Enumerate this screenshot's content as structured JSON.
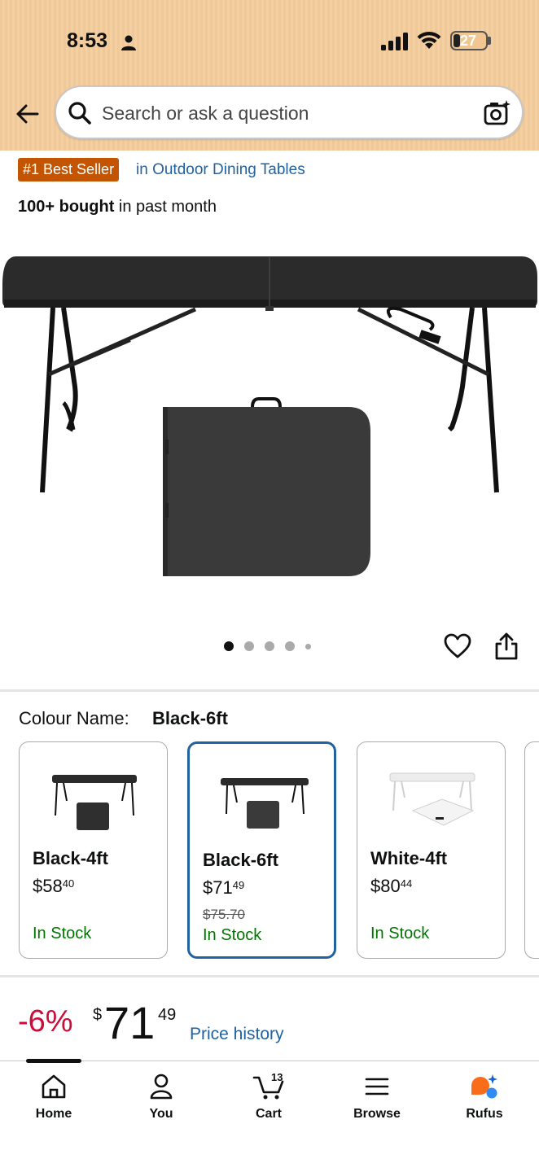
{
  "status_bar": {
    "time": "8:53",
    "battery": "27"
  },
  "search": {
    "placeholder": "Search or ask a question"
  },
  "badge": {
    "label": "#1 Best Seller",
    "category": "in Outdoor Dining Tables"
  },
  "bought": {
    "bold": "100+ bought",
    "rest": " in past month"
  },
  "colour": {
    "label": "Colour Name:",
    "value": "Black-6ft"
  },
  "variants": [
    {
      "name": "Black-4ft",
      "price_dollars": "$58",
      "price_cents": "40",
      "stock": "In Stock",
      "selected": false,
      "color": "black"
    },
    {
      "name": "Black-6ft",
      "price_dollars": "$71",
      "price_cents": "49",
      "was": "$75.70",
      "stock": "In Stock",
      "selected": true,
      "color": "black"
    },
    {
      "name": "White-4ft",
      "price_dollars": "$80",
      "price_cents": "44",
      "stock": "In Stock",
      "selected": false,
      "color": "white"
    }
  ],
  "price": {
    "discount": "-6%",
    "symbol": "$",
    "whole": "71",
    "cents": "49",
    "history_link": "Price history"
  },
  "tabs": [
    {
      "label": "Home",
      "icon": "home-icon"
    },
    {
      "label": "You",
      "icon": "person-icon"
    },
    {
      "label": "Cart",
      "icon": "cart-icon",
      "count": "13"
    },
    {
      "label": "Browse",
      "icon": "menu-icon"
    },
    {
      "label": "Rufus",
      "icon": "rufus-icon"
    }
  ],
  "colors": {
    "accent_link": "#2162a1",
    "bestseller": "#c45500",
    "stock_green": "#007600",
    "discount_red": "#cc0c39"
  }
}
